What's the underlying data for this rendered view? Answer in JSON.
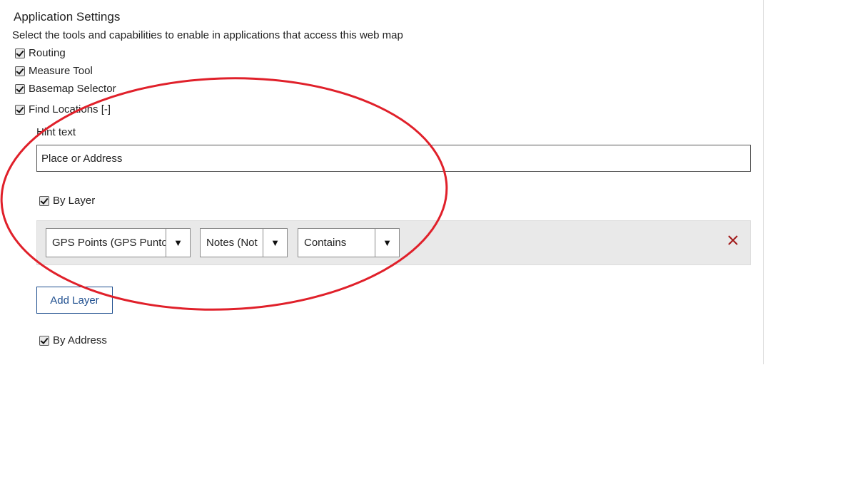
{
  "settings": {
    "title": "Application Settings",
    "subtitle": "Select the tools and capabilities to enable in applications that access this web map",
    "options": [
      {
        "label": "Routing",
        "checked": true
      },
      {
        "label": "Measure Tool",
        "checked": true
      },
      {
        "label": "Basemap Selector",
        "checked": true
      },
      {
        "label": "Find Locations [-]",
        "checked": true
      }
    ]
  },
  "find_locations": {
    "hint_label": "Hint text",
    "hint_value": "Place or Address",
    "by_layer": {
      "label": "By Layer",
      "checked": true
    },
    "layer_row": {
      "layer_select": "GPS Points (GPS Punto",
      "field_select": "Notes (Not",
      "operator_select": "Contains"
    },
    "add_layer_label": "Add Layer",
    "by_address": {
      "label": "By Address",
      "checked": true
    }
  },
  "annotation": {
    "color": "#e0202a"
  },
  "colors": {
    "accent": "#1f4f8f",
    "remove": "#a11a1a"
  }
}
